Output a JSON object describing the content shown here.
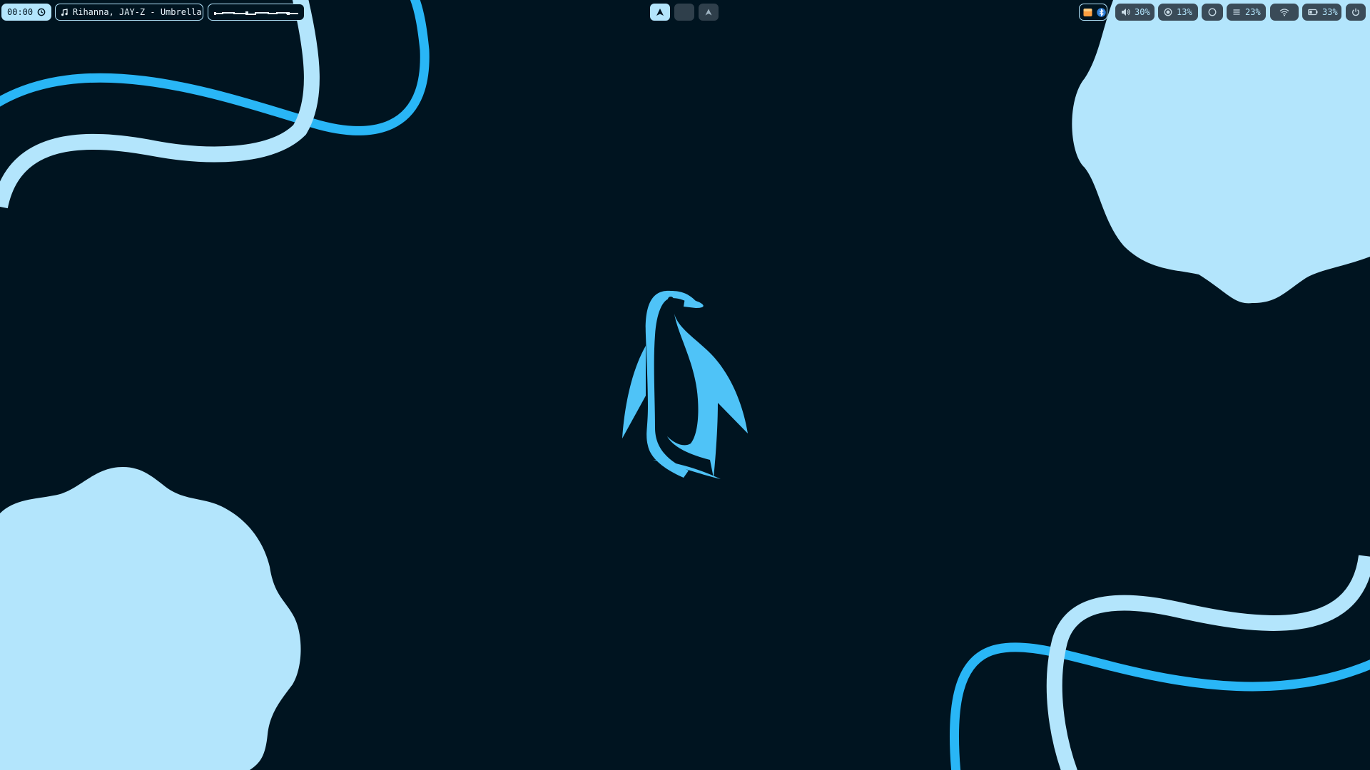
{
  "clock": {
    "time": "00:00",
    "icon": "clock-icon"
  },
  "media": {
    "icon": "music-note-icon",
    "title": "Rihanna, JAY-Z - Umbrella"
  },
  "visualizer": {
    "icon": "audio-visualizer-icon"
  },
  "workspaces": [
    {
      "id": 1,
      "icon": "arch-logo-icon",
      "active": true
    },
    {
      "id": 2,
      "icon": "",
      "active": false
    },
    {
      "id": 3,
      "icon": "arch-logo-icon",
      "active": false
    }
  ],
  "tray": {
    "icons": [
      "app-tray-icon",
      "bluetooth-icon"
    ]
  },
  "status": {
    "volume": {
      "icon": "speaker-icon",
      "value": "30%"
    },
    "cpu": {
      "icon": "cpu-icon",
      "value": "13%"
    },
    "circle": {
      "icon": "circle-icon"
    },
    "memory": {
      "icon": "memory-icon",
      "value": "23%"
    },
    "network": {
      "icon": "wifi-icon"
    },
    "battery": {
      "icon": "battery-icon",
      "value": "33%"
    },
    "power": {
      "icon": "power-icon"
    }
  },
  "colors": {
    "background": "#001420",
    "accent": "#29b6f6",
    "accent_light": "#b3e5fc",
    "penguin": "#4fc3f7"
  }
}
